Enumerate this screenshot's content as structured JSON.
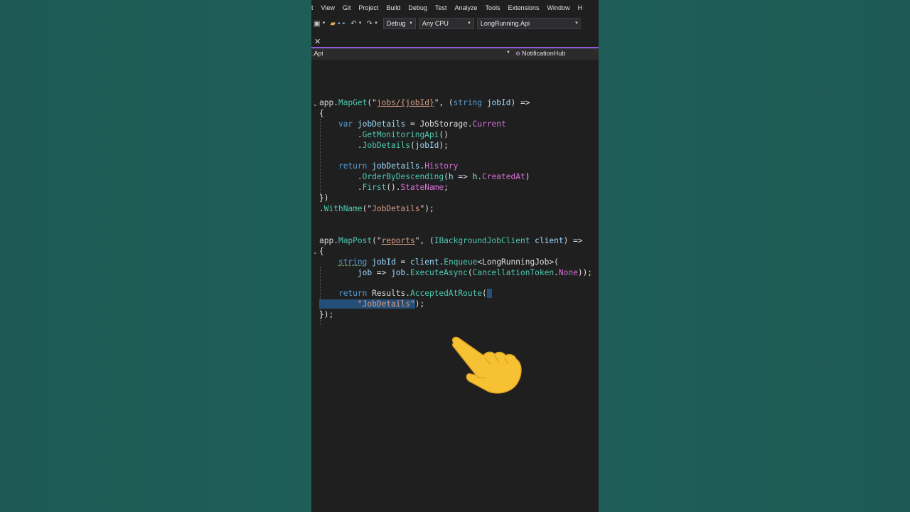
{
  "menu": [
    "t",
    "View",
    "Git",
    "Project",
    "Build",
    "Debug",
    "Test",
    "Analyze",
    "Tools",
    "Extensions",
    "Window",
    "H"
  ],
  "toolbar": {
    "config": "Debug",
    "platform": "Any CPU",
    "startup": "LongRunning.Api"
  },
  "tab": {
    "close_glyph": "✕"
  },
  "navbar": {
    "project": ".Api",
    "member": "NotificationHub"
  },
  "code": {
    "block1": {
      "route": "jobs/{jobId}",
      "storage_class": "JobStorage",
      "route_name": "JobDetails"
    },
    "block2": {
      "route": "reports",
      "job_class": "LongRunningJob",
      "route_name": "JobDetails"
    }
  },
  "overlay": {
    "pointer": "hand-pointing-emoji"
  },
  "colors": {
    "background": "#1f5f59",
    "editor": "#1f1f1f",
    "accent": "#8f5cd6",
    "keyword": "#569cd6",
    "method": "#4ec9b0",
    "property": "#d670d6",
    "string": "#d69d85",
    "selection": "#264f78"
  }
}
